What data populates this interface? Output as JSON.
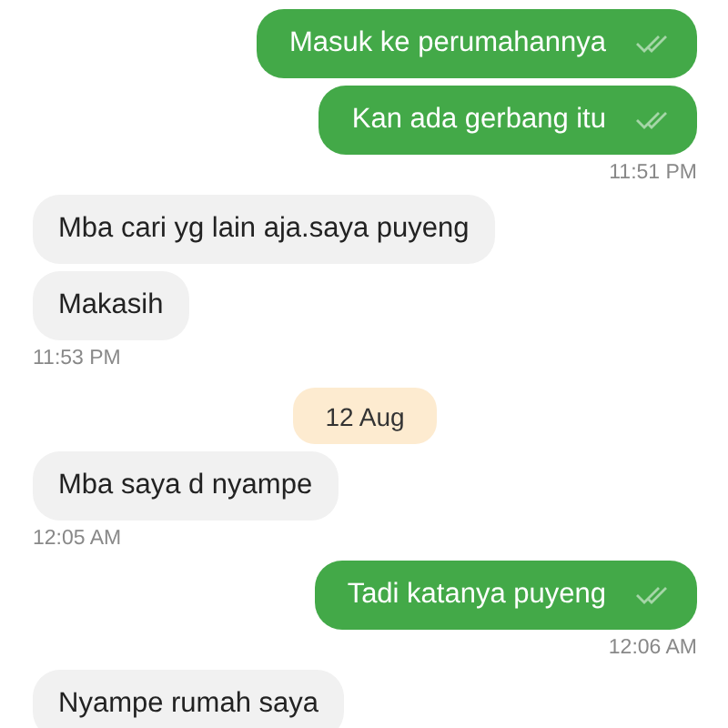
{
  "messages": [
    {
      "kind": "sent",
      "text": "Masuk ke perumahannya"
    },
    {
      "kind": "sent",
      "text": "Kan ada gerbang itu",
      "time": "11:51 PM"
    },
    {
      "kind": "received",
      "text": "Mba cari yg lain aja.saya puyeng"
    },
    {
      "kind": "received",
      "text": "Makasih",
      "time": "11:53 PM"
    },
    {
      "kind": "date",
      "text": "12 Aug"
    },
    {
      "kind": "received",
      "text": "Mba saya d nyampe",
      "time": "12:05 AM"
    },
    {
      "kind": "sent",
      "text": "Tadi katanya puyeng",
      "time": "12:06 AM"
    },
    {
      "kind": "received",
      "text": "Nyampe rumah saya"
    }
  ]
}
